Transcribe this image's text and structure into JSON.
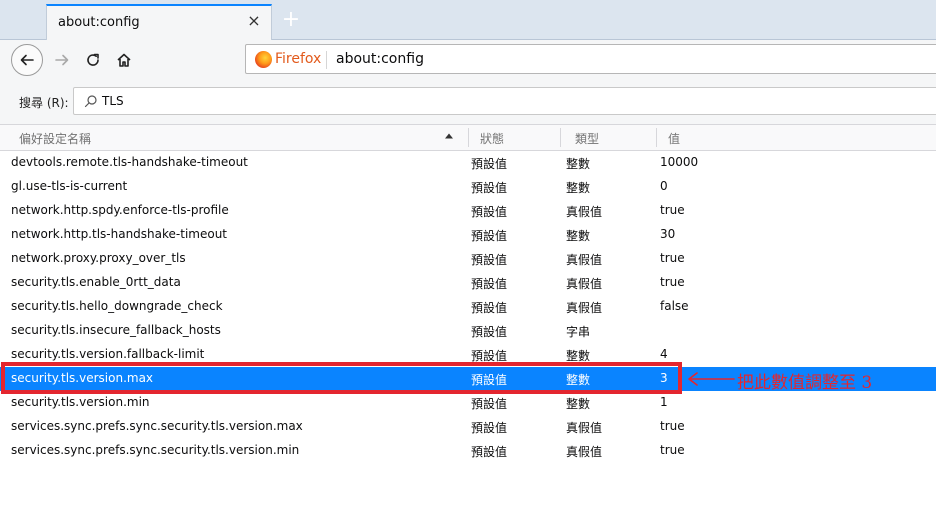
{
  "tab": {
    "title": "about:config",
    "close_glyph": "×",
    "new_tab_glyph": "+"
  },
  "nav": {
    "brand": "Firefox",
    "url": "about:config"
  },
  "search": {
    "label": "搜尋 (R):",
    "value": "TLS"
  },
  "columns": {
    "name": "偏好設定名稱",
    "status": "狀態",
    "type": "類型",
    "value": "值"
  },
  "rows": [
    {
      "name": "devtools.remote.tls-handshake-timeout",
      "status": "預設值",
      "type": "整數",
      "value": "10000"
    },
    {
      "name": "gl.use-tls-is-current",
      "status": "預設值",
      "type": "整數",
      "value": "0"
    },
    {
      "name": "network.http.spdy.enforce-tls-profile",
      "status": "預設值",
      "type": "真假值",
      "value": "true"
    },
    {
      "name": "network.http.tls-handshake-timeout",
      "status": "預設值",
      "type": "整數",
      "value": "30"
    },
    {
      "name": "network.proxy.proxy_over_tls",
      "status": "預設值",
      "type": "真假值",
      "value": "true"
    },
    {
      "name": "security.tls.enable_0rtt_data",
      "status": "預設值",
      "type": "真假值",
      "value": "true"
    },
    {
      "name": "security.tls.hello_downgrade_check",
      "status": "預設值",
      "type": "真假值",
      "value": "false"
    },
    {
      "name": "security.tls.insecure_fallback_hosts",
      "status": "預設值",
      "type": "字串",
      "value": ""
    },
    {
      "name": "security.tls.version.fallback-limit",
      "status": "預設值",
      "type": "整數",
      "value": "4"
    },
    {
      "name": "security.tls.version.max",
      "status": "預設值",
      "type": "整數",
      "value": "3"
    },
    {
      "name": "security.tls.version.min",
      "status": "預設值",
      "type": "整數",
      "value": "1"
    },
    {
      "name": "services.sync.prefs.sync.security.tls.version.max",
      "status": "預設值",
      "type": "真假值",
      "value": "true"
    },
    {
      "name": "services.sync.prefs.sync.security.tls.version.min",
      "status": "預設值",
      "type": "真假值",
      "value": "true"
    }
  ],
  "annotation": {
    "text": "把此數值調整至 3"
  },
  "colors": {
    "selection": "#0a84ff",
    "annotation": "#e3262f",
    "firefox_brand": "#e25a1c"
  },
  "icons": [
    "back-arrow-icon",
    "forward-arrow-icon",
    "reload-icon",
    "home-icon",
    "firefox-logo-icon",
    "search-icon",
    "sort-descending-icon",
    "close-icon",
    "plus-icon"
  ]
}
